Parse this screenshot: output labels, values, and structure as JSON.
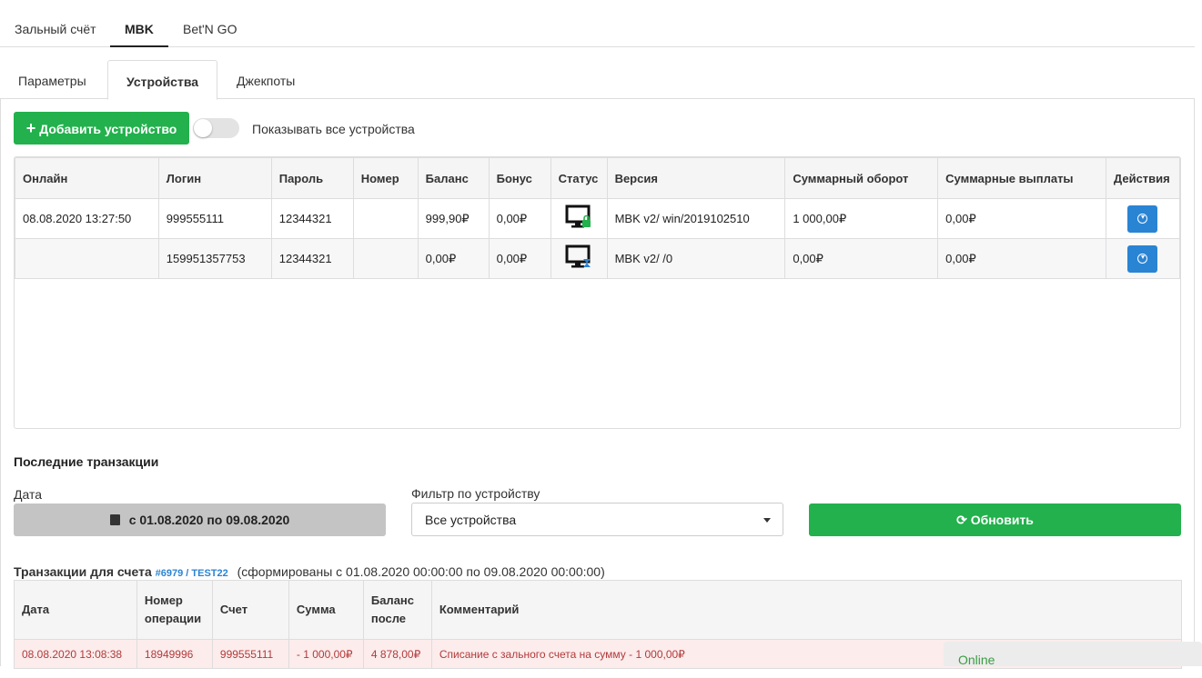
{
  "top_tabs": [
    "Зальный счёт",
    "MBK",
    "Bet'N GO"
  ],
  "sub_tabs": [
    "Параметры",
    "Устройства",
    "Джекпоты"
  ],
  "add_device_label": "Добавить устройство",
  "show_all_label": "Показывать все устройства",
  "show_all_enabled": false,
  "devices": {
    "headers": [
      "Онлайн",
      "Логин",
      "Пароль",
      "Номер",
      "Баланс",
      "Бонус",
      "Статус",
      "Версия",
      "Суммарный оборот",
      "Суммарные выплаты",
      "Действия"
    ],
    "rows": [
      {
        "online": "08.08.2020 13:27:50",
        "login": "999555111",
        "password": "12344321",
        "number": "",
        "balance": "999,90₽",
        "bonus": "0,00₽",
        "status_icon": "monitor-lock-icon",
        "version": "MBK v2/ win/2019102510",
        "turnover": "1 000,00₽",
        "payouts": "0,00₽"
      },
      {
        "online": "",
        "login": "159951357753",
        "password": "12344321",
        "number": "",
        "balance": "0,00₽",
        "bonus": "0,00₽",
        "status_icon": "monitor-hourglass-icon",
        "version": "MBK v2/ /0",
        "turnover": "0,00₽",
        "payouts": "0,00₽"
      }
    ]
  },
  "recent_title": "Последние транзакции",
  "date_label": "Дата",
  "date_range": "с 01.08.2020 по 09.08.2020",
  "filter_label": "Фильтр по устройству",
  "filter_value": "Все устройства",
  "refresh_label": "Обновить",
  "tx_title": {
    "prefix": "Транзакции для счета",
    "account": "#6979 / TEST22",
    "suffix": "(сформированы с 01.08.2020 00:00:00 по 09.08.2020 00:00:00)"
  },
  "transactions": {
    "headers": [
      "Дата",
      "Номер операции",
      "Счет",
      "Сумма",
      "Баланс после",
      "Комментарий"
    ],
    "rows": [
      {
        "date": "08.08.2020 13:08:38",
        "op": "18949996",
        "account": "999555111",
        "amount": "- 1 000,00₽",
        "balance": "4 878,00₽",
        "comment": "Списание с зального счета на сумму - 1 000,00₽"
      }
    ]
  },
  "online_label": "Online",
  "colors": {
    "green": "#22b14c",
    "blue": "#2a84d4",
    "debit_text": "#b23a3a",
    "debit_bg": "#fcecec"
  }
}
